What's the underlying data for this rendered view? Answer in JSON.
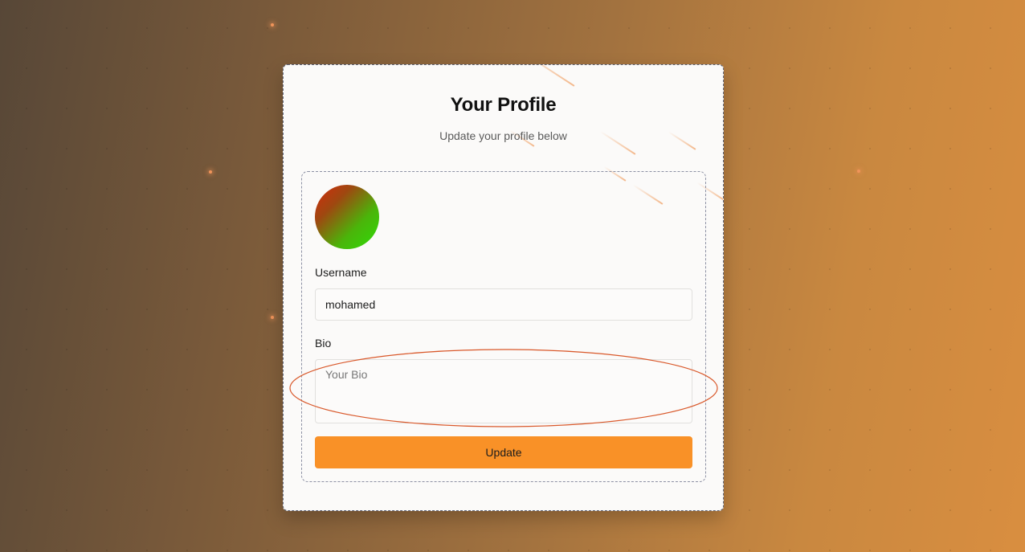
{
  "page": {
    "background_colors": [
      "#574737",
      "#d98e40"
    ]
  },
  "profile_card": {
    "title": "Your Profile",
    "subtitle": "Update your profile below",
    "avatar_colors": [
      "#d52a0e",
      "#2edc08"
    ],
    "form": {
      "username_label": "Username",
      "username_value": "mohamed",
      "bio_label": "Bio",
      "bio_placeholder": "Your Bio",
      "bio_value": "",
      "submit_label": "Update",
      "submit_color": "#f99127"
    }
  },
  "annotation": {
    "highlight_color": "#d9582a"
  }
}
